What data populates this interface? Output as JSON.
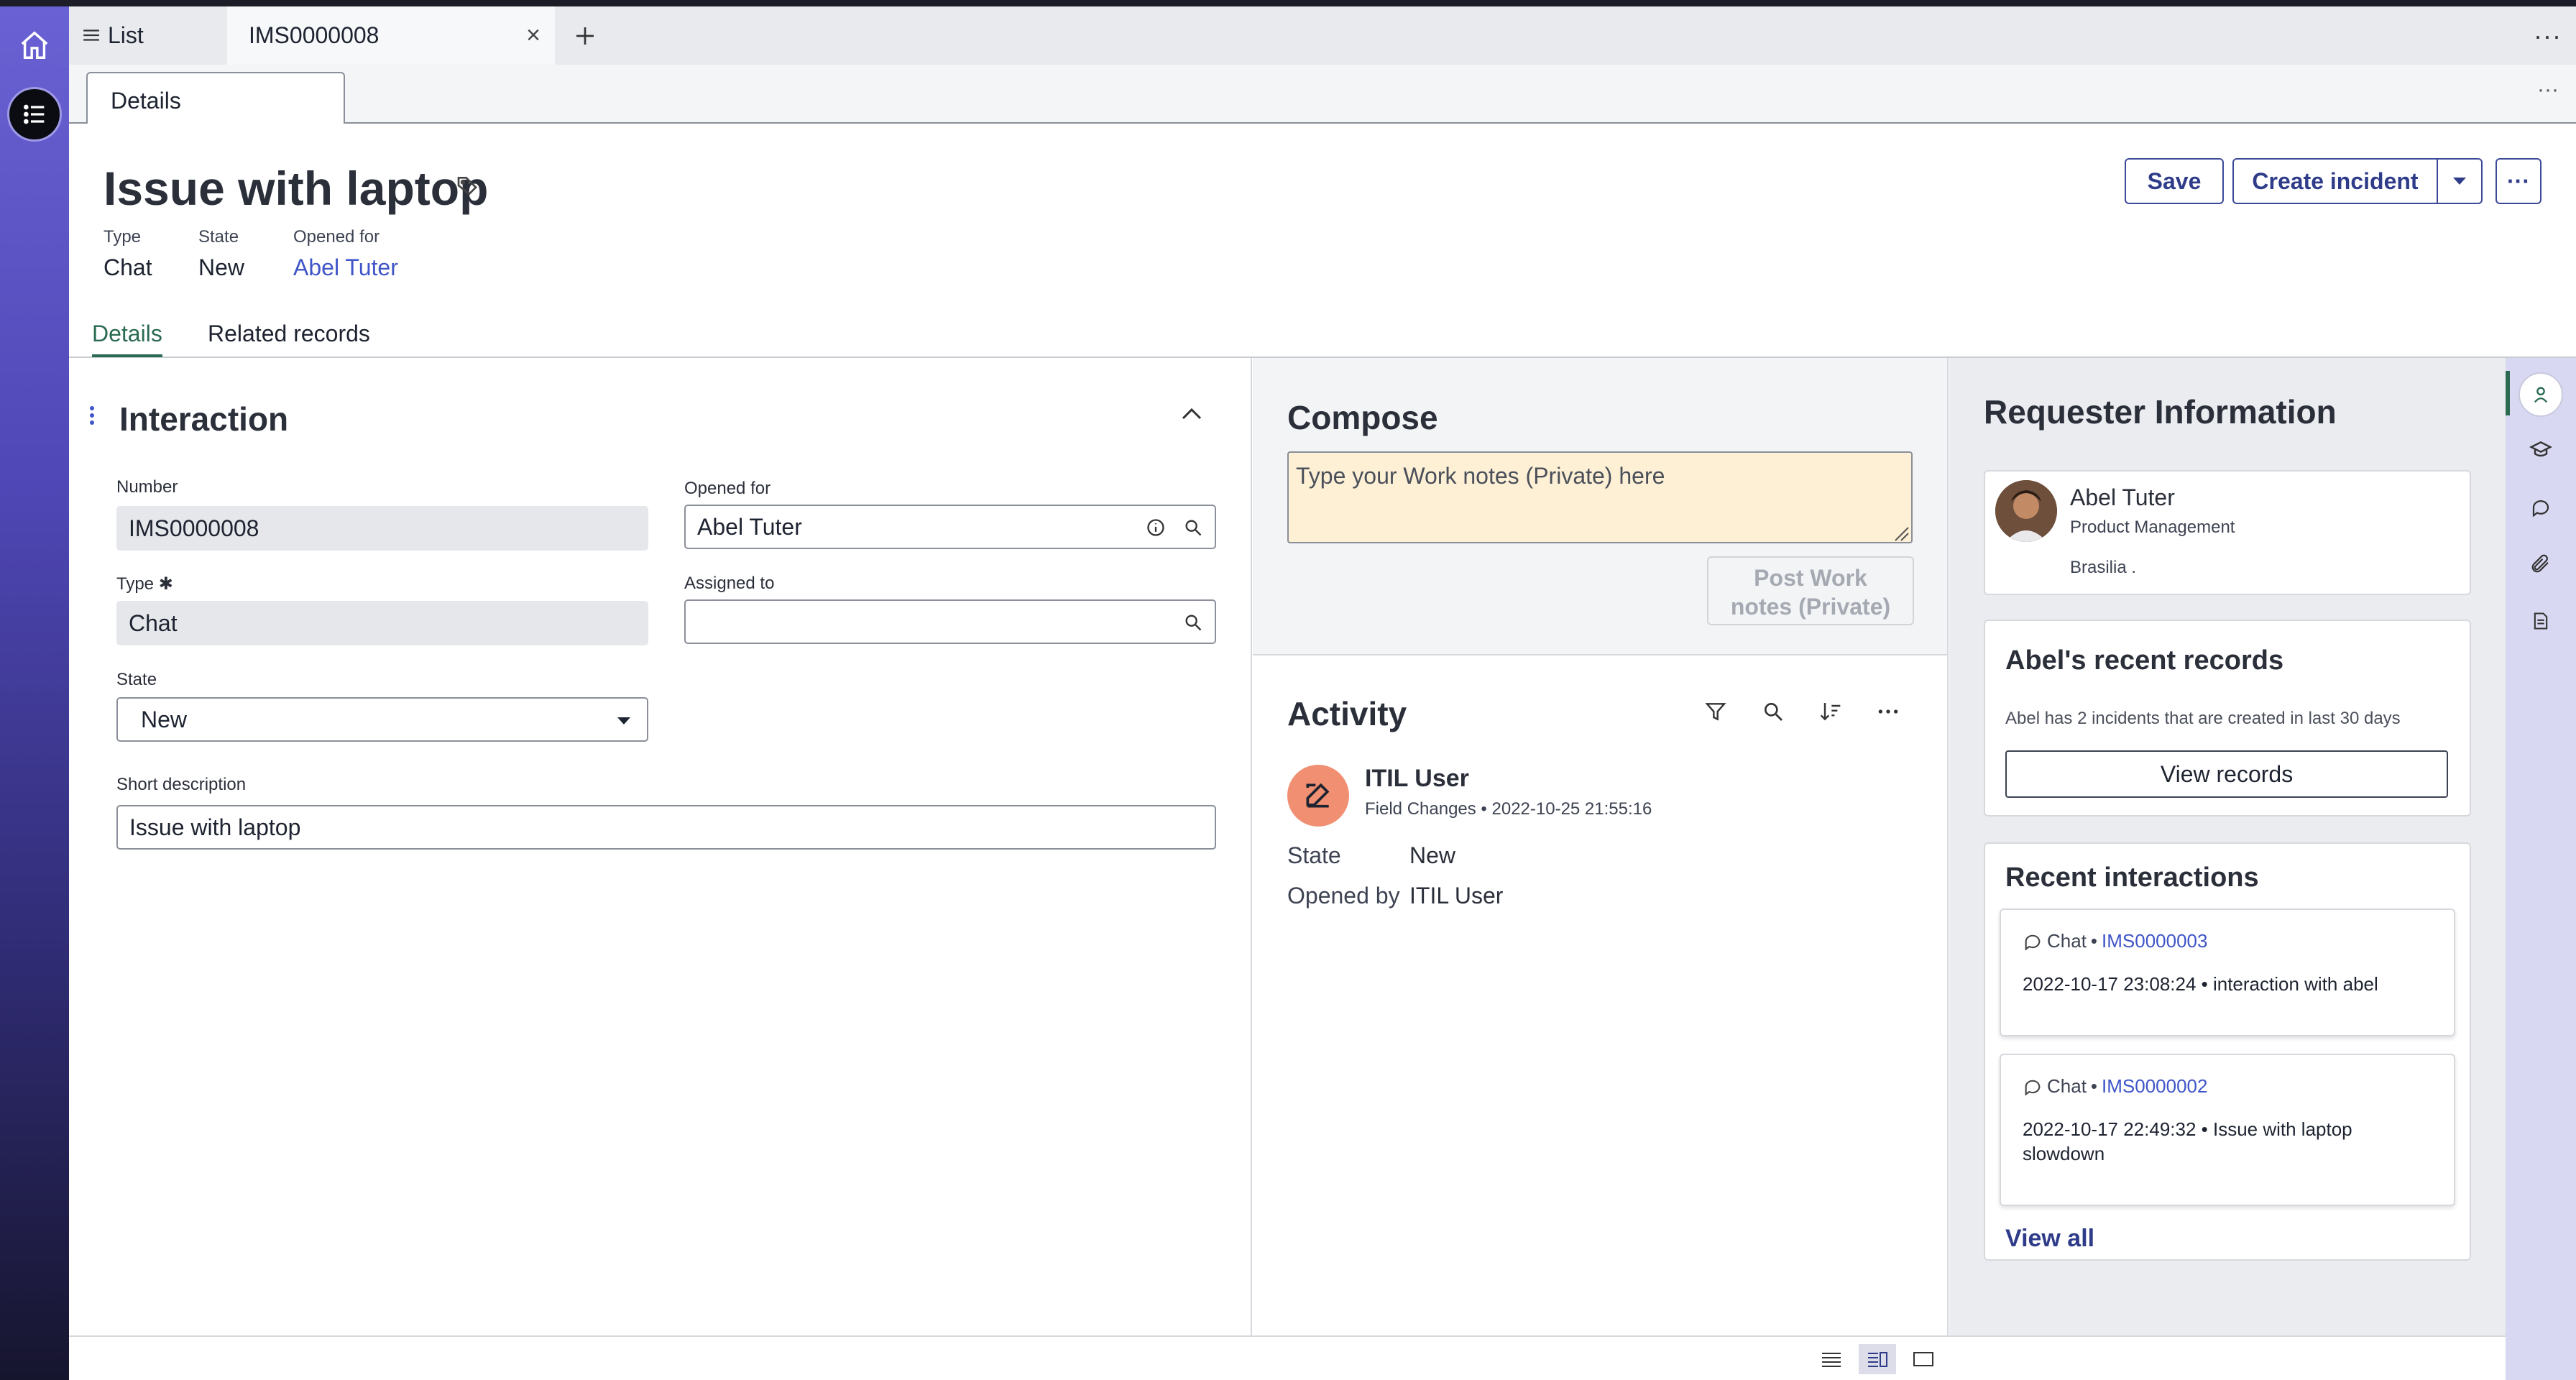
{
  "tabs": {
    "list_label": "List",
    "record_label": "IMS0000008",
    "close": "×",
    "add": "+",
    "more": "···"
  },
  "subtabs": {
    "details": "Details",
    "more": "···"
  },
  "record": {
    "title": "Issue with laptop",
    "meta": [
      {
        "label": "Type",
        "value": "Chat"
      },
      {
        "label": "State",
        "value": "New"
      },
      {
        "label": "Opened for",
        "value": "Abel Tuter"
      }
    ],
    "buttons": {
      "save": "Save",
      "create_incident": "Create incident",
      "more": "···"
    },
    "tabs": {
      "details": "Details",
      "related": "Related records"
    }
  },
  "interaction": {
    "title": "Interaction",
    "number_label": "Number",
    "number_value": "IMS0000008",
    "type_label": "Type ✱",
    "type_value": "Chat",
    "state_label": "State",
    "state_value": "New",
    "opened_for_label": "Opened for",
    "opened_for_value": "Abel Tuter",
    "assigned_to_label": "Assigned to",
    "assigned_to_value": "",
    "short_desc_label": "Short description",
    "short_desc_value": "Issue with laptop"
  },
  "compose": {
    "title": "Compose",
    "placeholder": "Type your Work notes (Private) here",
    "post_line1": "Post Work",
    "post_line2": "notes (Private)"
  },
  "activity": {
    "title": "Activity",
    "user": "ITIL User",
    "subtitle": "Field Changes • 2022-10-25 21:55:16",
    "rows": [
      {
        "key": "State",
        "value": "New"
      },
      {
        "key": "Opened by",
        "value": "ITIL User"
      }
    ]
  },
  "requester": {
    "title": "Requester Information",
    "name": "Abel Tuter",
    "department": "Product Management",
    "location": "Brasilia ."
  },
  "recent_records": {
    "title": "Abel's recent records",
    "text": "Abel has 2 incidents that are created in last 30 days",
    "button": "View records"
  },
  "recent_interactions": {
    "title": "Recent interactions",
    "items": [
      {
        "channel": "Chat",
        "sep": "•",
        "number": "IMS0000003",
        "body": "2022-10-17 23:08:24 • interaction with abel"
      },
      {
        "channel": "Chat",
        "sep": "•",
        "number": "IMS0000002",
        "body": "2022-10-17 22:49:32 • Issue with laptop slowdown"
      }
    ],
    "view_all": "View all"
  },
  "colors": {
    "accent": "#2f3c8a",
    "link": "#3f55c8",
    "active_tab": "#2a6b52",
    "compose_bg": "#fdf0d5",
    "avatar_edit": "#f08f72"
  }
}
